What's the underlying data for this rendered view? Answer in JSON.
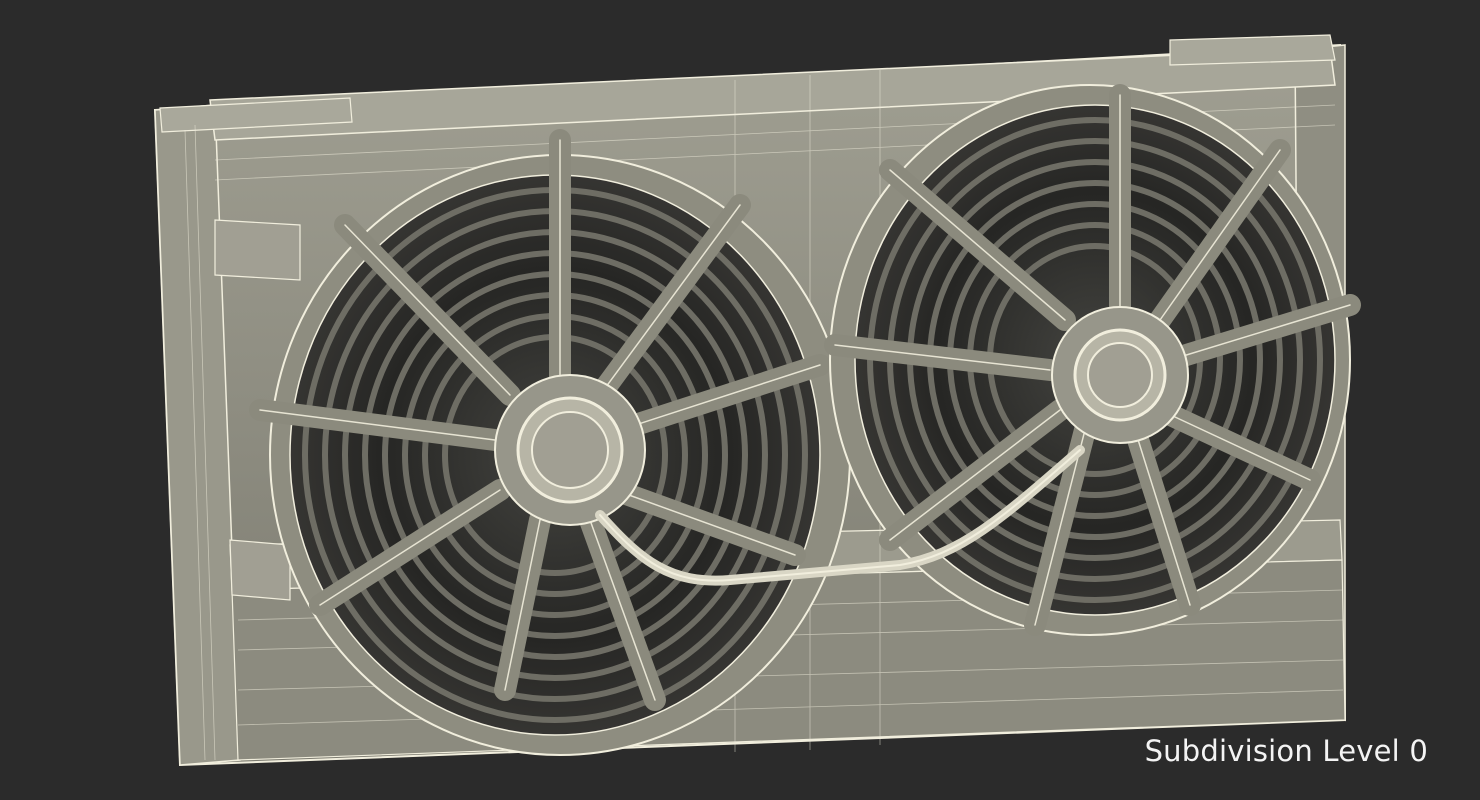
{
  "caption": "Subdivision Level 0",
  "colors": {
    "background": "#2b2b2b",
    "model": "#8b8a7d",
    "wire": "#f1eedd",
    "shadow": "#1a1a18"
  }
}
